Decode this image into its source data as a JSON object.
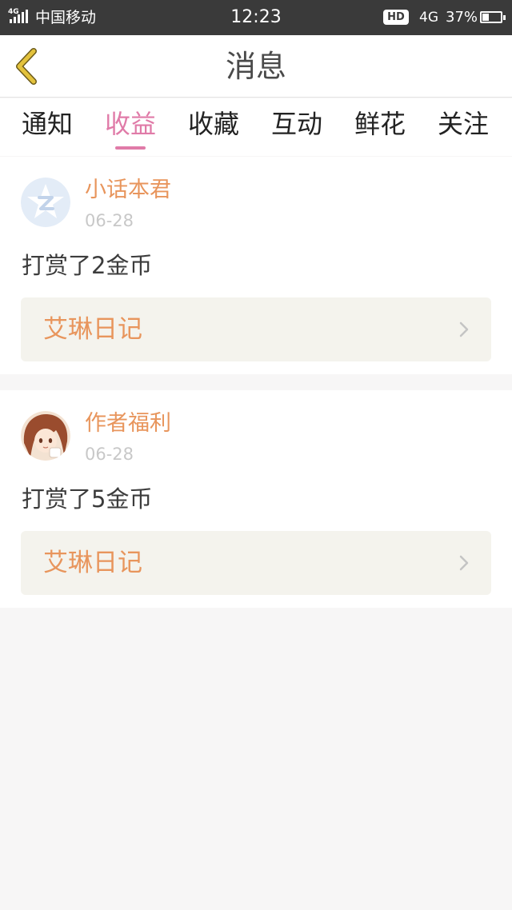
{
  "status_bar": {
    "network_small": "4G",
    "carrier": "中国移动",
    "time": "12:23",
    "hd_badge": "HD",
    "network": "4G",
    "battery_percent": "37%",
    "battery_level": 0.37
  },
  "header": {
    "back_icon": "chevron-left-icon",
    "title": "消息"
  },
  "tabs": [
    {
      "label": "通知",
      "active": false
    },
    {
      "label": "收益",
      "active": true
    },
    {
      "label": "收藏",
      "active": false
    },
    {
      "label": "互动",
      "active": false
    },
    {
      "label": "鲜花",
      "active": false
    },
    {
      "label": "关注",
      "active": false
    }
  ],
  "colors": {
    "accent_pink": "#e07ba8",
    "accent_orange": "#e8955c",
    "date_gray": "#c8c8c8",
    "book_bg": "#f4f3ed",
    "back_icon": "#e3c23c"
  },
  "messages": [
    {
      "sender": "小话本君",
      "avatar": "app-logo-avatar",
      "date": "06-28",
      "text": "打赏了2金币",
      "book": "艾琳日记"
    },
    {
      "sender": "作者福利",
      "avatar": "anime-girl-avatar",
      "date": "06-28",
      "text": "打赏了5金币",
      "book": "艾琳日记"
    }
  ]
}
